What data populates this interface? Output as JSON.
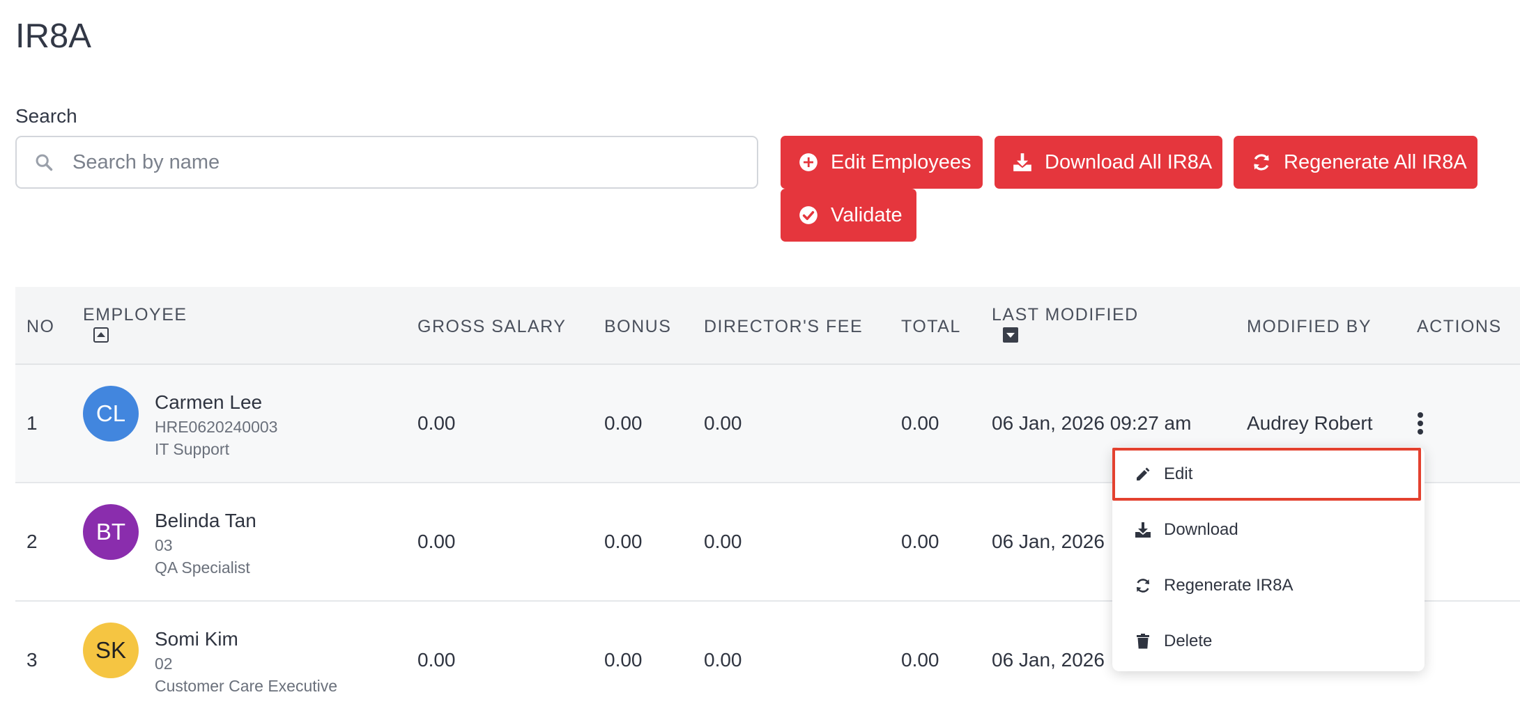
{
  "page": {
    "title": "IR8A"
  },
  "search": {
    "label": "Search",
    "placeholder": "Search by name"
  },
  "buttons": {
    "edit_employees": "Edit Employees",
    "download_all": "Download All IR8A",
    "regenerate_all": "Regenerate All IR8A",
    "validate": "Validate"
  },
  "table": {
    "headers": {
      "no": "NO",
      "employee": "EMPLOYEE",
      "gross_salary": "GROSS SALARY",
      "bonus": "BONUS",
      "directors_fee": "DIRECTOR'S FEE",
      "total": "TOTAL",
      "last_modified": "LAST MODIFIED",
      "modified_by": "MODIFIED BY",
      "actions": "ACTIONS"
    },
    "rows": [
      {
        "no": "1",
        "initials": "CL",
        "avatar_color": "#4286de",
        "name": "Carmen Lee",
        "code": "HRE0620240003",
        "role": "IT Support",
        "gross_salary": "0.00",
        "bonus": "0.00",
        "directors_fee": "0.00",
        "total": "0.00",
        "last_modified": "06 Jan, 2026 09:27 am",
        "modified_by": "Audrey Robert"
      },
      {
        "no": "2",
        "initials": "BT",
        "avatar_color": "#8a2dad",
        "name": "Belinda Tan",
        "code": "03",
        "role": "QA Specialist",
        "gross_salary": "0.00",
        "bonus": "0.00",
        "directors_fee": "0.00",
        "total": "0.00",
        "last_modified": "06 Jan, 2026 ",
        "modified_by": ""
      },
      {
        "no": "3",
        "initials": "SK",
        "avatar_color": "#f5c542",
        "name": "Somi Kim",
        "code": "02",
        "role": "Customer Care Executive",
        "gross_salary": "0.00",
        "bonus": "0.00",
        "directors_fee": "0.00",
        "total": "0.00",
        "last_modified": "06 Jan, 2026 ",
        "modified_by": ""
      }
    ]
  },
  "actions_menu": {
    "items": [
      {
        "label": "Edit",
        "icon": "pencil-icon"
      },
      {
        "label": "Download",
        "icon": "download-icon"
      },
      {
        "label": "Regenerate IR8A",
        "icon": "refresh-icon"
      },
      {
        "label": "Delete",
        "icon": "trash-icon"
      }
    ]
  },
  "colors": {
    "primary": "#e5363d",
    "highlight": "#e3412f"
  }
}
